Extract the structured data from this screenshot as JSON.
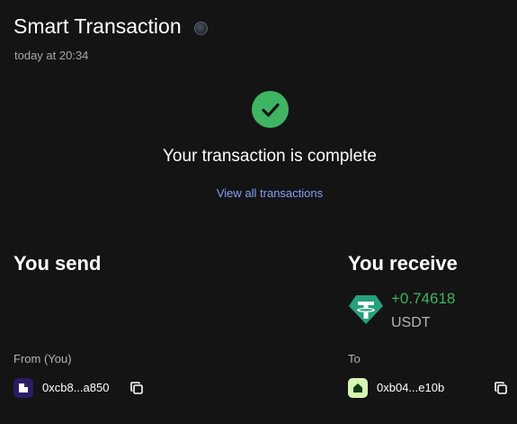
{
  "header": {
    "title": "Smart Transaction",
    "timestamp": "today at 20:34"
  },
  "status": {
    "message": "Your transaction is complete",
    "link": "View all transactions",
    "icon": "check-circle-icon",
    "color": "#3fb463"
  },
  "send": {
    "heading": "You send",
    "from_label": "From (You)",
    "from_address": "0xcb8...a850"
  },
  "receive": {
    "heading": "You receive",
    "amount": "+0.74618",
    "token": "USDT",
    "token_icon": "tether-icon",
    "to_label": "To",
    "to_address": "0xb04...e10b"
  },
  "colors": {
    "background": "#141414",
    "accent_link": "#8b9cf6",
    "positive": "#3fb463"
  }
}
